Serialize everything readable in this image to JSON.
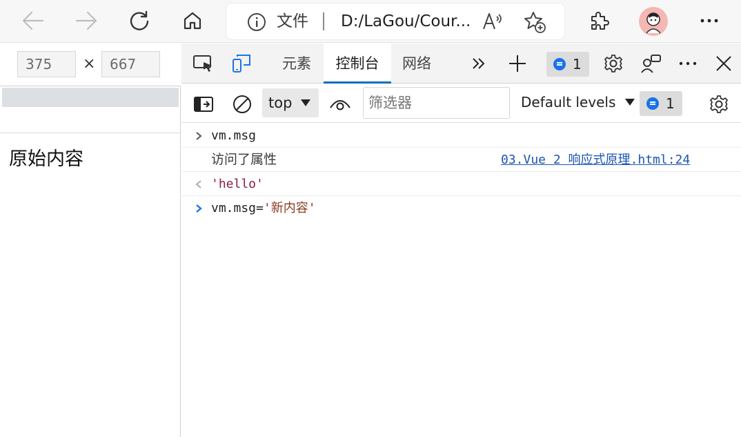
{
  "browser": {
    "address_label": "文件",
    "url": "D:/LaGou/Cour...",
    "icons": [
      "back-icon",
      "forward-icon",
      "refresh-icon",
      "home-icon",
      "info-icon",
      "read-aloud-icon",
      "add-favorite-icon",
      "extensions-icon",
      "more-icon"
    ]
  },
  "viewport": {
    "width_value": "375",
    "times": "×",
    "height_value": "667",
    "page_text": "原始内容"
  },
  "devtools": {
    "tabs": [
      {
        "label": "元素",
        "active": false
      },
      {
        "label": "控制台",
        "active": true
      },
      {
        "label": "网络",
        "active": false
      }
    ],
    "issues_count": "1",
    "context": "top",
    "filter_placeholder": "筛选器",
    "levels": "Default levels",
    "toolbar_issues_count": "1"
  },
  "console": {
    "rows": [
      {
        "type": "input",
        "text": "vm.msg"
      },
      {
        "type": "log",
        "text": "访问了属性",
        "source": "03.Vue 2 响应式原理.html:24"
      },
      {
        "type": "result",
        "text": "'hello'"
      },
      {
        "type": "prompt",
        "code": "vm.msg=",
        "string": "'新内容'"
      }
    ]
  },
  "colors": {
    "accent": "#0f6cbd",
    "string": "#8b1e3f",
    "link": "#1a55b4",
    "avatar_bg": "#f4b7b4"
  }
}
